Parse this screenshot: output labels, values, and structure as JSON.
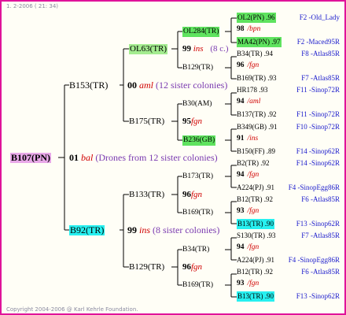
{
  "header": "1.  2-2006 ( 21: 34)",
  "footer": "Copyright 2004-2006 @ Karl Kehrle Foundation.",
  "root": "B107(PN)",
  "root_mating": {
    "year": "01",
    "code": "bal",
    "note": "(Drones from 12 sister colonies)"
  },
  "gen2": [
    {
      "name": "B153(TR)",
      "year": "00",
      "code": "aml",
      "note": "(12 sister colonies)"
    },
    {
      "name": "B92(TR)",
      "year": "99",
      "code": "ins",
      "note": "(8 sister colonies)"
    }
  ],
  "gen3": [
    {
      "name": "OL63(TR)",
      "year": "99",
      "code": "ins",
      "note": "(8 c.)"
    },
    {
      "name": "B175(TR)",
      "year": "95",
      "code": "fgn",
      "note": ""
    },
    {
      "name": "B133(TR)",
      "year": "96",
      "code": "fgn",
      "note": ""
    },
    {
      "name": "B129(TR)",
      "year": "96",
      "code": "fgn",
      "note": ""
    }
  ],
  "gen4": [
    "OL284(TR)",
    "B129(TR)",
    "B30(AM)",
    "B236(GB)",
    "B173(TR)",
    "B169(TR)",
    "B34(TR)",
    "B169(TR)"
  ],
  "gen5": [
    {
      "kind": "bee",
      "name": "OL2(PN) .96",
      "hl": "green",
      "line": "F2 -Old_Lady"
    },
    {
      "kind": "mat",
      "year": "98",
      "code": "/bpn"
    },
    {
      "kind": "bee",
      "name": "MA42(PN) .97",
      "hl": "green",
      "line": "F2 -Maced95R"
    },
    {
      "kind": "bee",
      "name": "B34(TR) .94",
      "hl": "",
      "line": "F8 -Atlas85R"
    },
    {
      "kind": "mat",
      "year": "96",
      "code": "/fgn"
    },
    {
      "kind": "bee",
      "name": "B169(TR) .93",
      "hl": "",
      "line": "F7 -Atlas85R"
    },
    {
      "kind": "bee",
      "name": "HR178 .93",
      "hl": "",
      "line": "F11 -Sinop72R"
    },
    {
      "kind": "mat",
      "year": "94",
      "code": "/aml"
    },
    {
      "kind": "bee",
      "name": "B137(TR) .92",
      "hl": "",
      "line": "F11 -Sinop72R"
    },
    {
      "kind": "bee",
      "name": "B349(GB) .91",
      "hl": "",
      "line": "F10 -Sinop72R"
    },
    {
      "kind": "mat",
      "year": "91",
      "code": "/ins"
    },
    {
      "kind": "bee",
      "name": "B150(FF) .89",
      "hl": "",
      "line": "F14 -Sinop62R"
    },
    {
      "kind": "bee",
      "name": "B2(TR) .92",
      "hl": "",
      "line": "F14 -Sinop62R"
    },
    {
      "kind": "mat",
      "year": "94",
      "code": "/fgn"
    },
    {
      "kind": "bee",
      "name": "A224(PJ) .91",
      "hl": "",
      "line": "F4 -SinopEgg86R"
    },
    {
      "kind": "bee",
      "name": "B12(TR) .92",
      "hl": "",
      "line": "F6 -Atlas85R"
    },
    {
      "kind": "mat",
      "year": "93",
      "code": "/fgn"
    },
    {
      "kind": "bee",
      "name": "B13(TR) .90",
      "hl": "cyan",
      "line": "F13 -Sinop62R"
    },
    {
      "kind": "bee",
      "name": "S130(TR) .93",
      "hl": "",
      "line": "F7 -Atlas85R"
    },
    {
      "kind": "mat",
      "year": "94",
      "code": "/fgn"
    },
    {
      "kind": "bee",
      "name": "A224(PJ) .91",
      "hl": "",
      "line": "F4 -SinopEgg86R"
    },
    {
      "kind": "bee",
      "name": "B12(TR) .92",
      "hl": "",
      "line": "F6 -Atlas85R"
    },
    {
      "kind": "mat",
      "year": "93",
      "code": "/fgn"
    },
    {
      "kind": "bee",
      "name": "B13(TR) .90",
      "hl": "cyan",
      "line": "F13 -Sinop62R"
    }
  ],
  "colors": {
    "border": "#e0139a",
    "root_highlight": "#e8a8e8",
    "green_highlight": "#5fe35f",
    "cyan_highlight": "#27f0f0",
    "mating_code": "#d00000",
    "line_name": "#1a1acc",
    "note": "#7a3ab0"
  }
}
